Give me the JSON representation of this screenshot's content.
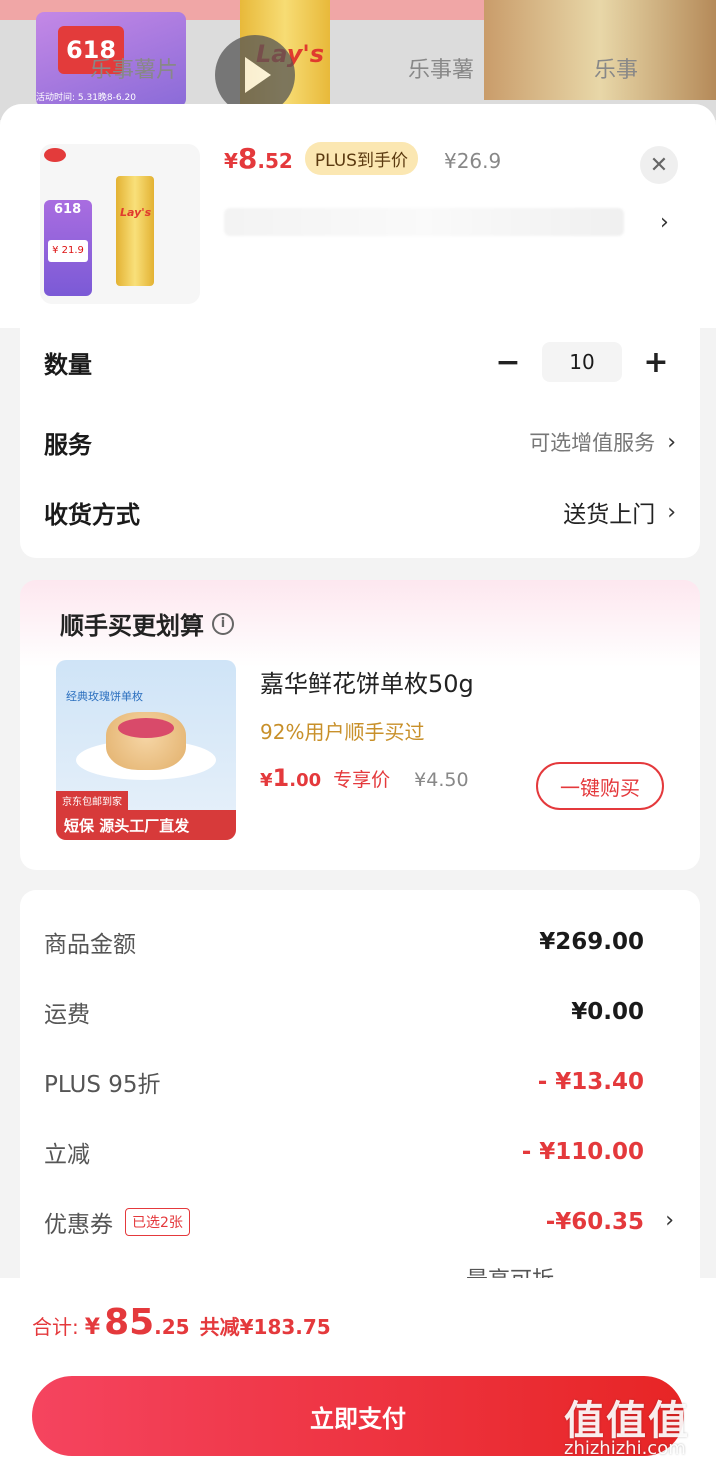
{
  "background": {
    "badge_618": "618",
    "brand": "Lay's",
    "text_left": "乐事薯片",
    "text_mid": "乐事薯",
    "text_right": "乐事",
    "event_time": "活动时间: 5.31晚8-6.20"
  },
  "product": {
    "price_yen": "¥",
    "price_int": "8",
    "price_dec": ".52",
    "plus_badge": "PLUS到手价",
    "orig_price": "¥26.9",
    "thumb_618": "618",
    "thumb_price": "¥ 21.9",
    "thumb_brand": "Lay's"
  },
  "options": {
    "qty_label": "数量",
    "qty_value": "10",
    "service_label": "服务",
    "service_value": "可选增值服务",
    "delivery_label": "收货方式",
    "delivery_value": "送货上门"
  },
  "addon": {
    "title": "顺手买更划算",
    "name": "嘉华鲜花饼单枚50g",
    "buyers": "92%用户顺手买过",
    "price_yen": "¥",
    "price_int": "1",
    "price_dec": ".00",
    "tag": "专享价",
    "orig": "¥4.50",
    "buy_label": "一键购买",
    "img_label": "经典玫瑰饼单枚",
    "img_banner": "短保 源头工厂直发",
    "img_banner_small": "京东包邮到家"
  },
  "summary": {
    "goods_label": "商品金额",
    "goods_value": "¥269.00",
    "shipping_label": "运费",
    "shipping_value": "¥0.00",
    "plus_label": "PLUS 95折",
    "plus_value": "- ¥13.40",
    "instant_label": "立减",
    "instant_value": "- ¥110.00",
    "coupon_label": "优惠券",
    "coupon_badge": "已选2张",
    "coupon_value": "-¥60.35",
    "partial": "最高可折"
  },
  "footer": {
    "total_label": "合计:",
    "total_yen": "¥",
    "total_int": "85",
    "total_dec": ".25",
    "total_save": "共减¥183.75",
    "pay_label": "立即支付"
  },
  "watermark": {
    "text": "值值值",
    "url": "zhizhizhi.com"
  }
}
